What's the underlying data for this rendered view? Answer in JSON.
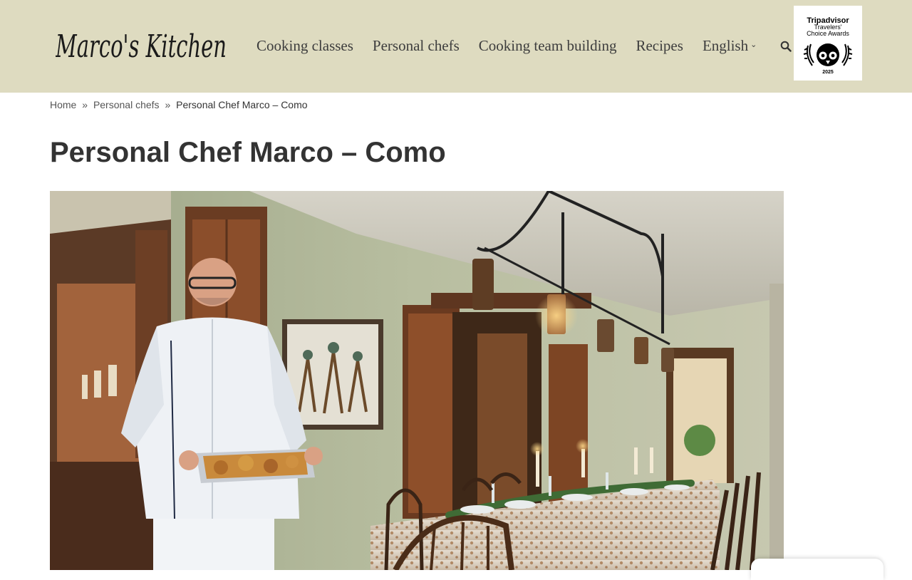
{
  "site": {
    "logo_text": "Marco's Kitchen"
  },
  "nav": {
    "items": [
      "Cooking classes",
      "Personal chefs",
      "Cooking team building",
      "Recipes"
    ],
    "language": "English"
  },
  "award": {
    "line1": "Tripadvisor",
    "line2": "Travelers'",
    "line3": "Choice Awards",
    "year": "2025"
  },
  "breadcrumb": {
    "home": "Home",
    "sep": "»",
    "parent": "Personal chefs",
    "current": "Personal Chef Marco – Como"
  },
  "page": {
    "title": "Personal Chef Marco – Como"
  },
  "icons": {
    "search": "search-icon",
    "dropdown": "chevron-down-icon"
  },
  "colors": {
    "header_bg": "#dedbc0",
    "text": "#333333"
  }
}
